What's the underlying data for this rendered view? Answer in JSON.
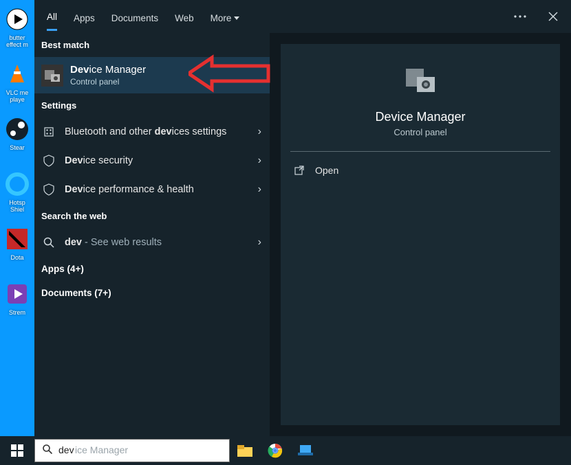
{
  "desktop_icons": [
    {
      "label": "butter\neffect m"
    },
    {
      "label": "VLC me\nplaye"
    },
    {
      "label": "Stear"
    },
    {
      "label": "Hotsp\nShiel"
    },
    {
      "label": "Dota"
    },
    {
      "label": "Strem"
    }
  ],
  "tabs": {
    "all": "All",
    "apps": "Apps",
    "documents": "Documents",
    "web": "Web",
    "more": "More"
  },
  "best_match_label": "Best match",
  "best_match": {
    "title_bold": "Dev",
    "title_rest": "ice Manager",
    "subtitle": "Control panel"
  },
  "settings_label": "Settings",
  "settings_items": [
    {
      "before": "Bluetooth and other ",
      "bold": "dev",
      "after": "ices settings"
    },
    {
      "before": "",
      "bold": "Dev",
      "after": "ice security"
    },
    {
      "before": "",
      "bold": "Dev",
      "after": "ice performance & health"
    }
  ],
  "web_label": "Search the web",
  "web_item": {
    "bold": "dev",
    "suffix_label": " - See web results"
  },
  "apps_category": "Apps (4+)",
  "documents_category": "Documents (7+)",
  "detail": {
    "title": "Device Manager",
    "subtitle": "Control panel",
    "open": "Open"
  },
  "search": {
    "prefix": "dev",
    "ghost": "ice Manager"
  }
}
